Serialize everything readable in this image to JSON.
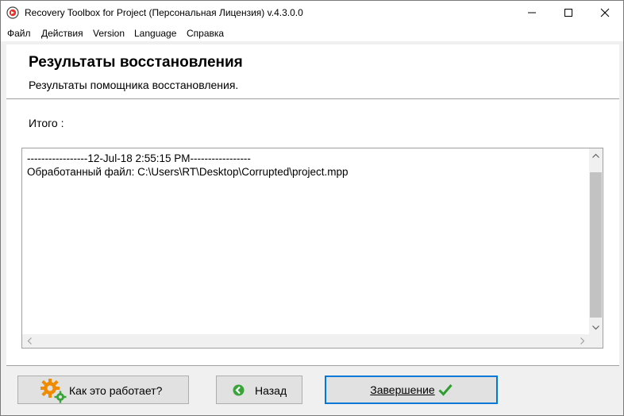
{
  "window": {
    "title": "Recovery Toolbox for Project (Персональная Лицензия) v.4.3.0.0"
  },
  "menu": {
    "items": [
      "Файл",
      "Действия",
      "Version",
      "Language",
      "Справка"
    ]
  },
  "header": {
    "title": "Результаты восстановления",
    "subtitle": "Результаты помощника восстановления."
  },
  "content": {
    "summary_label": "Итого :",
    "log_lines": [
      "-----------------12-Jul-18 2:55:15 PM-----------------",
      "Обработанный файл: C:\\Users\\RT\\Desktop\\Corrupted\\project.mpp"
    ]
  },
  "buttons": {
    "how_it_works": "Как это работает?",
    "back": "Назад",
    "finish": "Завершение"
  },
  "colors": {
    "accent": "#0078d7",
    "check_green": "#2e9e2e",
    "gear_orange": "#f08a00",
    "back_green": "#3aa33a"
  }
}
